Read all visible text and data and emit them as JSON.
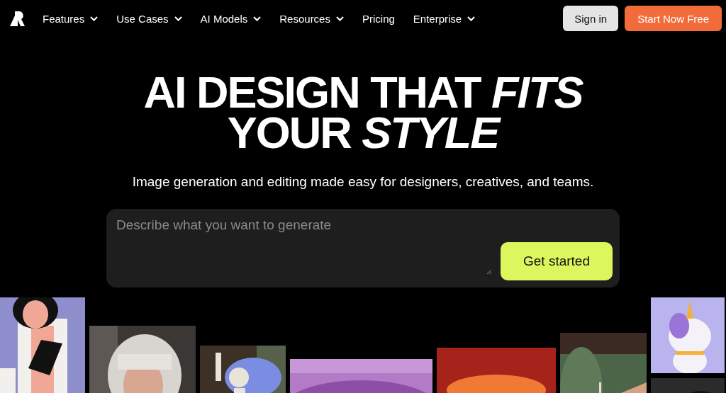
{
  "header": {
    "nav": [
      {
        "label": "Features",
        "dropdown": true
      },
      {
        "label": "Use Cases",
        "dropdown": true
      },
      {
        "label": "AI Models",
        "dropdown": true
      },
      {
        "label": "Resources",
        "dropdown": true
      },
      {
        "label": "Pricing",
        "dropdown": false
      },
      {
        "label": "Enterprise",
        "dropdown": true
      }
    ],
    "buttons": [
      {
        "label": "Sign in",
        "kind": "secondary"
      },
      {
        "label": "Start Now Free",
        "kind": "primary"
      }
    ]
  },
  "hero": {
    "headline": [
      "AI DESIGN THAT *FITS*",
      "YOUR *STYLE*"
    ],
    "subtitle": "Image generation and editing made easy for designers, creatives, and teams."
  },
  "prompt": {
    "placeholder": "Describe what you want to generate",
    "button": "Get started"
  }
}
